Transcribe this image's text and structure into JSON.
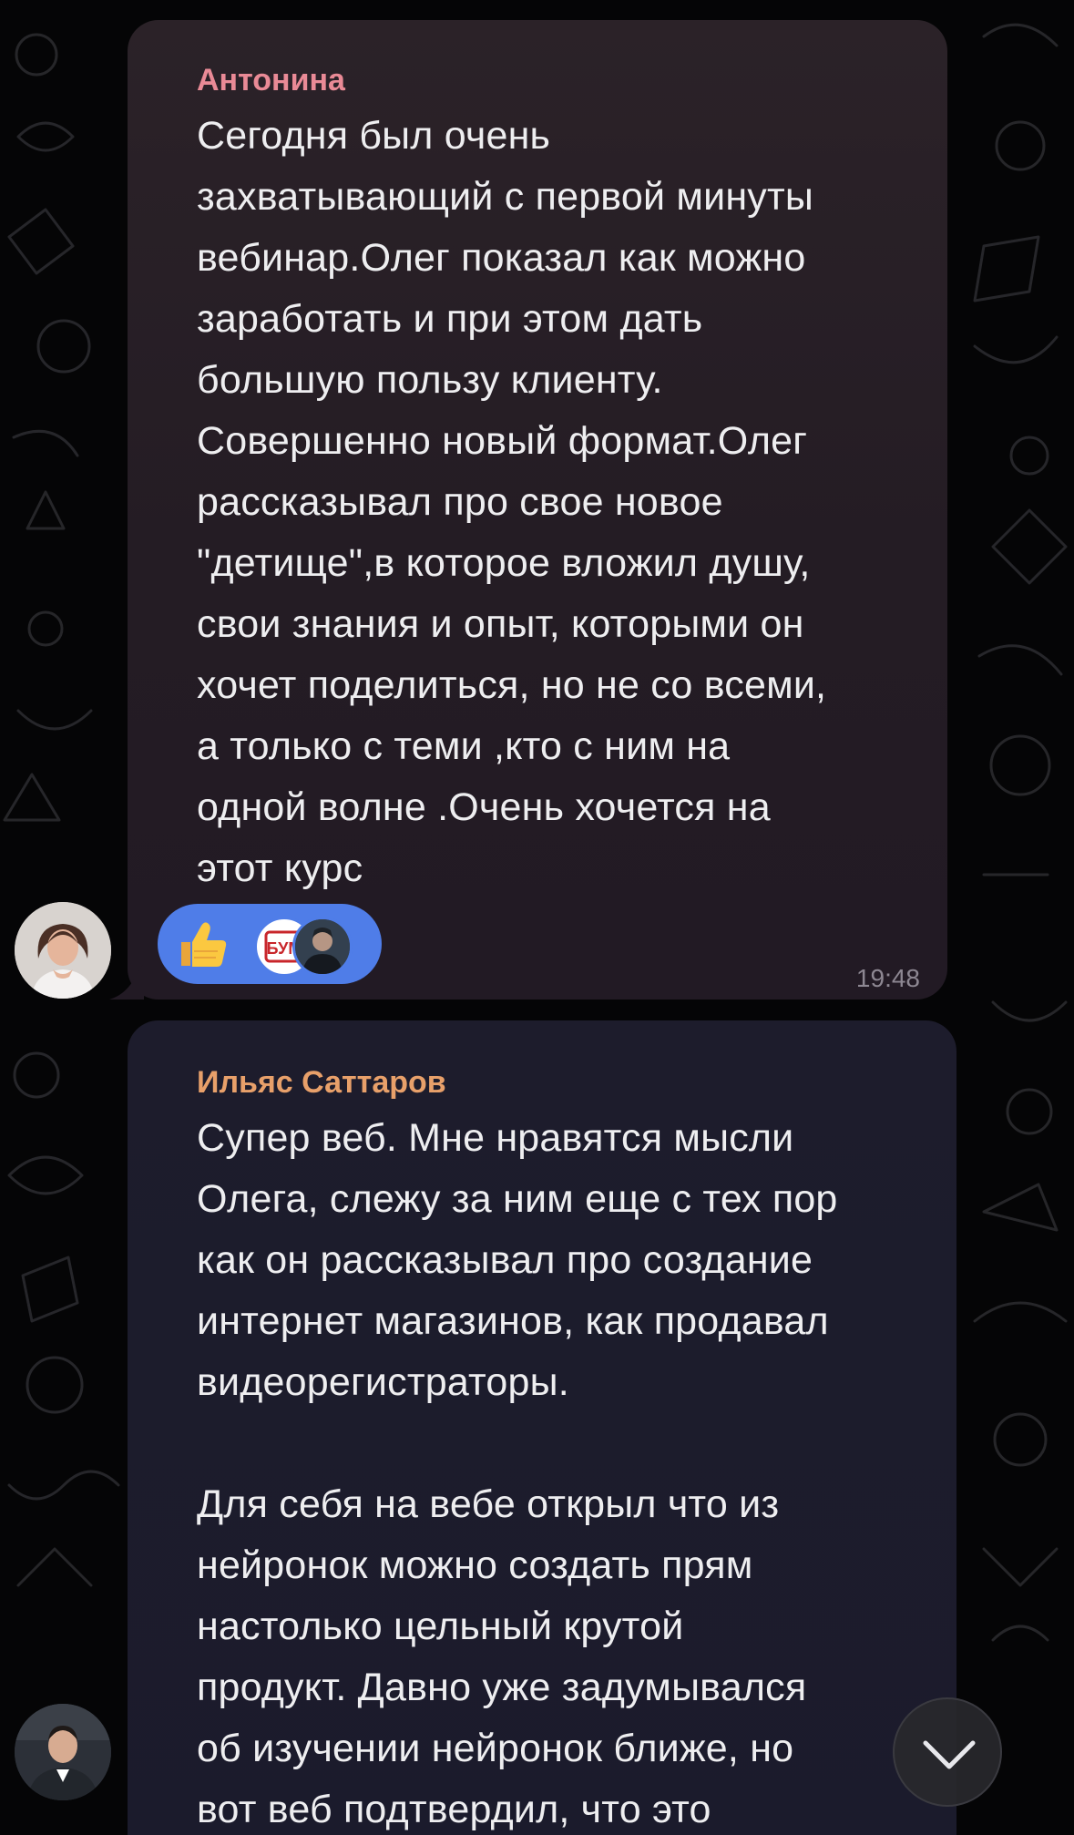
{
  "messages": [
    {
      "author": "Антонина",
      "lines": [
        "Сегодня был очень",
        "захватывающий с первой минуты",
        "вебинар.Олег показал как можно",
        "заработать и при этом дать",
        "большую пользу клиенту.",
        "Совершенно новый формат.Олег",
        "рассказывал про свое новое",
        "\"детище\",в которое вложил душу,",
        "свои знания и опыт, которыми он",
        "хочет поделиться, но не со всеми,",
        "а только с теми ,кто с ним на",
        "одной волне .Очень хочется на",
        "этот курс"
      ],
      "reaction": {
        "emoji": "thumbs-up",
        "avatar1_text": "БУМ"
      },
      "time": "19:48",
      "author_color": "#e98a96"
    },
    {
      "author": "Ильяс Саттаров",
      "lines": [
        "Супер веб. Мне нравятся мысли",
        "Олега, слежу за ним еще с тех пор",
        "как он рассказывал про создание",
        "интернет магазинов, как продавал",
        "видеорегистраторы.",
        "",
        "Для себя на вебе открыл что из",
        "нейронок можно создать прям",
        "настолько цельный крутой",
        "продукт. Давно уже задумывался",
        "об изучении нейронок ближе, но",
        "вот веб подтвердил, что это"
      ],
      "author_color": "#e8a06a"
    }
  ],
  "icons": {
    "scroll_down": "chevron-down-icon",
    "reaction": "thumbs-up-icon"
  },
  "colors": {
    "background": "#050506",
    "bubble_1": "#2b2228",
    "bubble_2": "#1d1c2c",
    "reaction_chip": "#4f7de8",
    "text": "#eeeef0",
    "time": "#8d8792"
  }
}
